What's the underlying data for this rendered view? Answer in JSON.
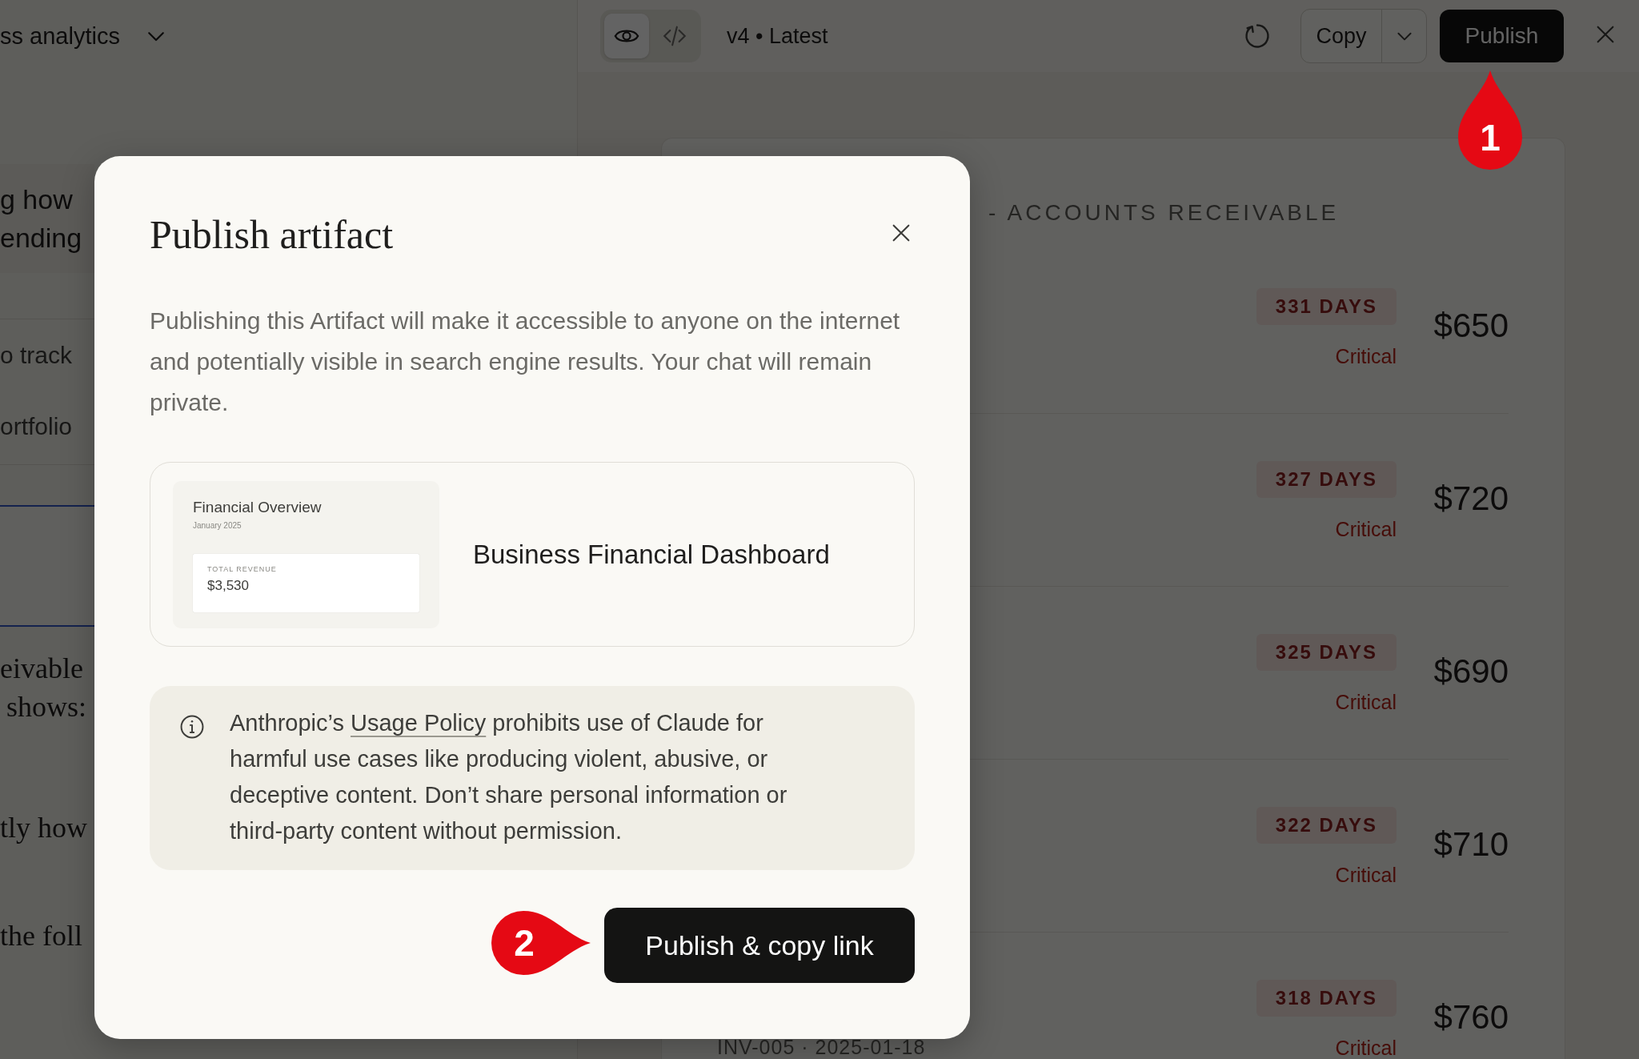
{
  "chat": {
    "title": "ss analytics",
    "blocks": [
      {
        "kind": "highlight",
        "lines": [
          "g how",
          "ending"
        ]
      },
      {
        "kind": "sans",
        "lines": [
          "o track",
          "ortfolio"
        ]
      },
      {
        "kind": "artifact"
      },
      {
        "kind": "serif",
        "lines": [
          "eivable",
          "shows:"
        ]
      },
      {
        "kind": "serif",
        "lines": [
          "tly how"
        ]
      },
      {
        "kind": "serif",
        "lines": [
          "the foll"
        ]
      }
    ]
  },
  "artifact_toolbar": {
    "views": [
      {
        "kind": "eye",
        "selected": true
      },
      {
        "kind": "code",
        "selected": false
      }
    ],
    "version": "v4 • Latest",
    "copy_label": "Copy",
    "publish_label": "Publish"
  },
  "receivables": {
    "heading": "- ACCOUNTS RECEIVABLE",
    "rows": [
      {
        "days": "331 DAYS",
        "status": "Critical",
        "amount": "$650"
      },
      {
        "days": "327 DAYS",
        "status": "Critical",
        "amount": "$720"
      },
      {
        "days": "325 DAYS",
        "status": "Critical",
        "amount": "$690"
      },
      {
        "days": "322 DAYS",
        "status": "Critical",
        "amount": "$710"
      },
      {
        "invoice": "INV-005 · 2025-01-18",
        "days": "318 DAYS",
        "status": "Critical",
        "amount": "$760"
      }
    ]
  },
  "dialog": {
    "title": "Publish artifact",
    "description": "Publishing this Artifact will make it accessible to anyone on the internet and potentially visible in search engine results. Your chat will remain private.",
    "preview": {
      "thumb_title": "Financial Overview",
      "thumb_date": "January 2025",
      "thumb_metric_label": "TOTAL REVENUE",
      "thumb_metric_value": "$3,530",
      "name": "Business Financial Dashboard"
    },
    "notice": {
      "before": "Anthropic’s ",
      "link": "Usage Policy",
      "after": " prohibits use of Claude for harmful use cases like producing violent, abusive, or deceptive content. Don’t share personal information or third-party content without permission."
    },
    "confirm_label": "Publish & copy link"
  },
  "annotations": [
    {
      "label": "1"
    },
    {
      "label": "2"
    }
  ]
}
